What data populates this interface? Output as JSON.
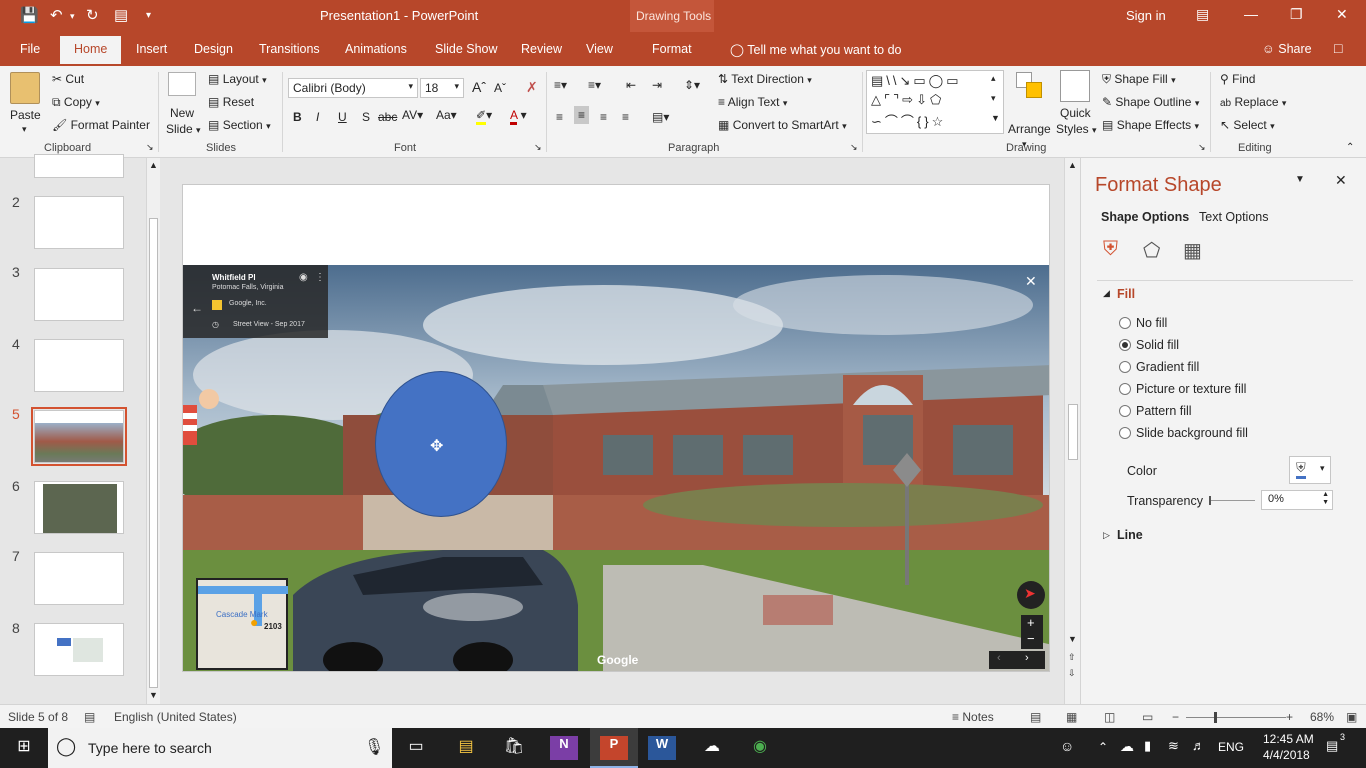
{
  "app": {
    "title": "Presentation1  -  PowerPoint",
    "contextual_header": "Drawing Tools",
    "sign_in": "Sign in"
  },
  "tabs": [
    "File",
    "Home",
    "Insert",
    "Design",
    "Transitions",
    "Animations",
    "Slide Show",
    "Review",
    "View",
    "Format"
  ],
  "active_tab": "Home",
  "tell_me": "Tell me what you want to do",
  "share": "Share",
  "ribbon": {
    "clipboard": {
      "paste": "Paste",
      "cut": "Cut",
      "copy": "Copy",
      "format_painter": "Format Painter",
      "label": "Clipboard"
    },
    "slides": {
      "new_slide_1": "New",
      "new_slide_2": "Slide",
      "layout": "Layout",
      "reset": "Reset",
      "section": "Section",
      "label": "Slides"
    },
    "font": {
      "family": "Calibri (Body)",
      "size": "18",
      "bold": "B",
      "italic": "I",
      "underline": "U",
      "shadow": "S",
      "strike": "abc",
      "label": "Font"
    },
    "paragraph": {
      "text_direction": "Text Direction",
      "align_text": "Align Text",
      "convert_smartart": "Convert to SmartArt",
      "label": "Paragraph"
    },
    "drawing": {
      "arrange": "Arrange",
      "quick_styles_1": "Quick",
      "quick_styles_2": "Styles",
      "shape_fill": "Shape Fill",
      "shape_outline": "Shape Outline",
      "shape_effects": "Shape Effects",
      "label": "Drawing"
    },
    "editing": {
      "find": "Find",
      "replace": "Replace",
      "select": "Select",
      "label": "Editing"
    }
  },
  "thumbnails": [
    {
      "num": "2"
    },
    {
      "num": "3"
    },
    {
      "num": "4"
    },
    {
      "num": "5"
    },
    {
      "num": "6"
    },
    {
      "num": "7"
    },
    {
      "num": "8"
    }
  ],
  "streetview": {
    "place": "Whitfield Pl",
    "locality": "Potomac Falls, Virginia",
    "credit": "Google, Inc.",
    "date": "Street View - Sep 2017",
    "watermark": "Google",
    "map_label": "Cascade Mark",
    "map_num": "2103"
  },
  "format_pane": {
    "title": "Format Shape",
    "tab_shape": "Shape Options",
    "tab_text": "Text Options",
    "section_fill": "Fill",
    "options": [
      "No fill",
      "Solid fill",
      "Gradient fill",
      "Picture or texture fill",
      "Pattern fill",
      "Slide background fill"
    ],
    "selected_option": "Solid fill",
    "color_label": "Color",
    "transparency_label": "Transparency",
    "transparency_value": "0%",
    "section_line": "Line"
  },
  "status": {
    "slide": "Slide 5 of 8",
    "language": "English (United States)",
    "notes": "Notes",
    "zoom": "68%"
  },
  "taskbar": {
    "search_placeholder": "Type here to search",
    "lang": "ENG",
    "time": "12:45 AM",
    "date": "4/4/2018",
    "notifications": "3"
  },
  "colors": {
    "accent": "#b7472a",
    "shape_fill": "#4472c4"
  }
}
